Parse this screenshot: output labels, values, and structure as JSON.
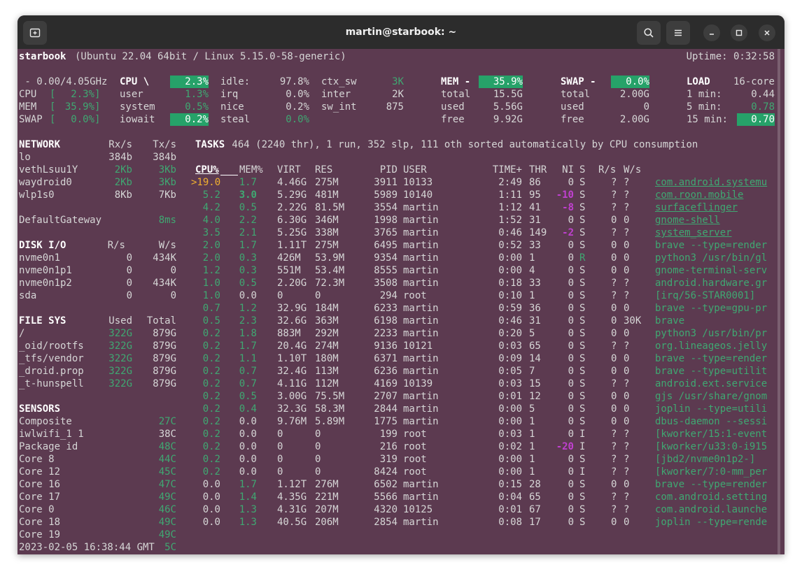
{
  "window": {
    "title": "martin@starbook: ~"
  },
  "header": {
    "host": "starbook",
    "sysinfo": "(Ubuntu 22.04 64bit / Linux 5.15.0-58-generic)",
    "uptime": "Uptime: 0:32:58"
  },
  "quicklook": {
    "freq": " - 0.00/4.05GHz",
    "rows": [
      {
        "label": "CPU",
        "pct": " 2.3%"
      },
      {
        "label": "MEM",
        "pct": "35.9%"
      },
      {
        "label": "SWAP",
        "pct": " 0.0%"
      }
    ]
  },
  "cpu": {
    "title": "CPU \\",
    "total": "2.3%",
    "rows": [
      {
        "k": "user",
        "v": "1.3%"
      },
      {
        "k": "system",
        "v": "0.5%"
      },
      {
        "k": "iowait",
        "v": "0.2%"
      }
    ],
    "rows2": [
      {
        "k": "idle:",
        "v": "97.8%"
      },
      {
        "k": "irq",
        "v": "0.0%"
      },
      {
        "k": "nice",
        "v": "0.2%"
      },
      {
        "k": "steal",
        "v": "0.0%"
      }
    ],
    "rows3": [
      {
        "k": "ctx_sw",
        "v": "3K"
      },
      {
        "k": "inter",
        "v": "2K"
      },
      {
        "k": "sw_int",
        "v": "875"
      }
    ]
  },
  "mem": {
    "title": "MEM -",
    "total_pct": "35.9%",
    "rows": [
      {
        "k": "total",
        "v": "15.5G"
      },
      {
        "k": "used",
        "v": "5.56G"
      },
      {
        "k": "free",
        "v": "9.92G"
      }
    ]
  },
  "swap": {
    "title": "SWAP -",
    "total_pct": "0.0%",
    "rows": [
      {
        "k": "total",
        "v": "2.00G"
      },
      {
        "k": "used",
        "v": "0"
      },
      {
        "k": "free",
        "v": "2.00G"
      }
    ]
  },
  "load": {
    "title": "LOAD",
    "cores": "16-core",
    "rows": [
      {
        "k": "1 min:",
        "v": "0.44"
      },
      {
        "k": "5 min:",
        "v": "0.78"
      },
      {
        "k": "15 min:",
        "v": "0.70"
      }
    ]
  },
  "network": {
    "title": "NETWORK",
    "rx": "Rx/s",
    "tx": "Tx/s",
    "rows": [
      {
        "name": "lo",
        "rx": "384b",
        "tx": "384b"
      },
      {
        "name": "vethLsuu1Y",
        "rx": "2Kb",
        "tx": "3Kb"
      },
      {
        "name": "waydroid0",
        "rx": "2Kb",
        "tx": "3Kb"
      },
      {
        "name": "wlp1s0",
        "rx": "8Kb",
        "tx": "7Kb"
      }
    ],
    "gateway": {
      "name": "DefaultGateway",
      "val": "8ms"
    }
  },
  "diskio": {
    "title": "DISK I/O",
    "r": "R/s",
    "w": "W/s",
    "rows": [
      {
        "name": "nvme0n1",
        "r": "0",
        "w": "434K"
      },
      {
        "name": "nvme0n1p1",
        "r": "0",
        "w": "0"
      },
      {
        "name": "nvme0n1p2",
        "r": "0",
        "w": "434K"
      },
      {
        "name": "sda",
        "r": "0",
        "w": "0"
      }
    ]
  },
  "filesys": {
    "title": "FILE SYS",
    "used": "Used",
    "total": "Total",
    "rows": [
      {
        "name": "/",
        "used": "322G",
        "total": "879G"
      },
      {
        "name": "_oid/rootfs",
        "used": "322G",
        "total": "879G"
      },
      {
        "name": "_tfs/vendor",
        "used": "322G",
        "total": "879G"
      },
      {
        "name": "_droid.prop",
        "used": "322G",
        "total": "879G"
      },
      {
        "name": "_t-hunspell",
        "used": "322G",
        "total": "879G"
      }
    ]
  },
  "sensors": {
    "title": "SENSORS",
    "rows": [
      {
        "name": "Composite",
        "val": "27C"
      },
      {
        "name": "iwlwifi_1 1",
        "val": "38C"
      },
      {
        "name": "Package id",
        "val": "48C"
      },
      {
        "name": "Core 8",
        "val": "44C"
      },
      {
        "name": "Core 12",
        "val": "45C"
      },
      {
        "name": "Core 16",
        "val": "47C"
      },
      {
        "name": "Core 17",
        "val": "49C"
      },
      {
        "name": "Core 0",
        "val": "46C"
      },
      {
        "name": "Core 18",
        "val": "49C"
      },
      {
        "name": "Core 19",
        "val": "49C"
      }
    ]
  },
  "footer": {
    "datetime": "2023-02-05 16:38:44 GMT",
    "lastsensor": "5C"
  },
  "tasks": {
    "summary_label": "TASKS",
    "summary": " 464 (2240 thr), 1 run, 352 slp, 111 oth sorted automatically by CPU consumption",
    "headers": {
      "cpu": "CPU%",
      "mem": "MEM%",
      "virt": "VIRT",
      "res": "RES",
      "pid": "PID",
      "user": "USER",
      "time": "TIME+",
      "thr": "THR",
      "ni": "NI",
      "s": "S",
      "rs": "R/s",
      "ws": "W/s"
    },
    "rows": [
      {
        "cpu": ">19.0",
        "mem": "1.7",
        "virt": "4.46G",
        "res": "275M",
        "pid": "3911",
        "user": "10133",
        "time": "2:49",
        "thr": "86",
        "ni": "0",
        "s": "S",
        "rs": "?",
        "ws": "?",
        "cmd": "com.android.systemu"
      },
      {
        "cpu": "5.2",
        "mem": "3.0",
        "virt": "5.29G",
        "res": "481M",
        "pid": "5989",
        "user": "10140",
        "time": "1:11",
        "thr": "95",
        "ni": "-10",
        "s": "S",
        "rs": "?",
        "ws": "?",
        "cmd": "com.roon.mobile"
      },
      {
        "cpu": "4.2",
        "mem": "0.5",
        "virt": "2.22G",
        "res": "81.5M",
        "pid": "3554",
        "user": "martin",
        "time": "1:12",
        "thr": "41",
        "ni": "-8",
        "s": "S",
        "rs": "?",
        "ws": "?",
        "cmd": "surfaceflinger"
      },
      {
        "cpu": "4.0",
        "mem": "2.2",
        "virt": "6.30G",
        "res": "346M",
        "pid": "1998",
        "user": "martin",
        "time": "1:52",
        "thr": "31",
        "ni": "0",
        "s": "S",
        "rs": "0",
        "ws": "0",
        "cmd": "gnome-shell"
      },
      {
        "cpu": "3.5",
        "mem": "2.1",
        "virt": "5.25G",
        "res": "338M",
        "pid": "3765",
        "user": "martin",
        "time": "0:46",
        "thr": "149",
        "ni": "-2",
        "s": "S",
        "rs": "?",
        "ws": "?",
        "cmd": "system_server"
      },
      {
        "cpu": "2.0",
        "mem": "1.7",
        "virt": "1.11T",
        "res": "275M",
        "pid": "6495",
        "user": "martin",
        "time": "0:52",
        "thr": "33",
        "ni": "0",
        "s": "S",
        "rs": "0",
        "ws": "0",
        "cmd": "brave --type=render"
      },
      {
        "cpu": "2.0",
        "mem": "0.3",
        "virt": "426M",
        "res": "53.9M",
        "pid": "9354",
        "user": "martin",
        "time": "0:00",
        "thr": "1",
        "ni": "0",
        "s": "R",
        "rs": "0",
        "ws": "0",
        "cmd": "python3 /usr/bin/gl"
      },
      {
        "cpu": "1.2",
        "mem": "0.3",
        "virt": "551M",
        "res": "53.4M",
        "pid": "8555",
        "user": "martin",
        "time": "0:00",
        "thr": "4",
        "ni": "0",
        "s": "S",
        "rs": "0",
        "ws": "0",
        "cmd": "gnome-terminal-serv"
      },
      {
        "cpu": "1.0",
        "mem": "0.5",
        "virt": "2.20G",
        "res": "72.3M",
        "pid": "3508",
        "user": "martin",
        "time": "0:18",
        "thr": "33",
        "ni": "0",
        "s": "S",
        "rs": "?",
        "ws": "?",
        "cmd": "android.hardware.gr"
      },
      {
        "cpu": "1.0",
        "mem": "0.0",
        "virt": "0",
        "res": "0",
        "pid": "294",
        "user": "root",
        "time": "0:10",
        "thr": "1",
        "ni": "0",
        "s": "S",
        "rs": "?",
        "ws": "?",
        "cmd": "[irq/56-STAR0001]"
      },
      {
        "cpu": "0.7",
        "mem": "1.2",
        "virt": "32.9G",
        "res": "184M",
        "pid": "6233",
        "user": "martin",
        "time": "0:59",
        "thr": "36",
        "ni": "0",
        "s": "S",
        "rs": "0",
        "ws": "0",
        "cmd": "brave --type=gpu-pr"
      },
      {
        "cpu": "0.5",
        "mem": "2.3",
        "virt": "32.6G",
        "res": "363M",
        "pid": "6198",
        "user": "martin",
        "time": "0:46",
        "thr": "31",
        "ni": "0",
        "s": "S",
        "rs": "0",
        "ws": "30K",
        "cmd": "brave"
      },
      {
        "cpu": "0.2",
        "mem": "1.8",
        "virt": "883M",
        "res": "292M",
        "pid": "2233",
        "user": "martin",
        "time": "0:20",
        "thr": "5",
        "ni": "0",
        "s": "S",
        "rs": "0",
        "ws": "0",
        "cmd": "python3 /usr/bin/pr"
      },
      {
        "cpu": "0.2",
        "mem": "1.7",
        "virt": "20.4G",
        "res": "274M",
        "pid": "9136",
        "user": "10121",
        "time": "0:03",
        "thr": "65",
        "ni": "0",
        "s": "S",
        "rs": "?",
        "ws": "?",
        "cmd": "org.lineageos.jelly"
      },
      {
        "cpu": "0.2",
        "mem": "1.1",
        "virt": "1.10T",
        "res": "180M",
        "pid": "6371",
        "user": "martin",
        "time": "0:09",
        "thr": "14",
        "ni": "0",
        "s": "S",
        "rs": "0",
        "ws": "0",
        "cmd": "brave --type=render"
      },
      {
        "cpu": "0.2",
        "mem": "0.7",
        "virt": "32.4G",
        "res": "113M",
        "pid": "6236",
        "user": "martin",
        "time": "0:05",
        "thr": "7",
        "ni": "0",
        "s": "S",
        "rs": "0",
        "ws": "0",
        "cmd": "brave --type=utilit"
      },
      {
        "cpu": "0.2",
        "mem": "0.7",
        "virt": "4.11G",
        "res": "112M",
        "pid": "4169",
        "user": "10139",
        "time": "0:03",
        "thr": "15",
        "ni": "0",
        "s": "S",
        "rs": "?",
        "ws": "?",
        "cmd": "android.ext.service"
      },
      {
        "cpu": "0.2",
        "mem": "0.5",
        "virt": "3.00G",
        "res": "75.5M",
        "pid": "2707",
        "user": "martin",
        "time": "0:01",
        "thr": "12",
        "ni": "0",
        "s": "S",
        "rs": "0",
        "ws": "0",
        "cmd": "gjs /usr/share/gnom"
      },
      {
        "cpu": "0.2",
        "mem": "0.4",
        "virt": "32.3G",
        "res": "58.3M",
        "pid": "2844",
        "user": "martin",
        "time": "0:00",
        "thr": "5",
        "ni": "0",
        "s": "S",
        "rs": "0",
        "ws": "0",
        "cmd": "joplin --type=utili"
      },
      {
        "cpu": "0.2",
        "mem": "0.0",
        "virt": "9.76M",
        "res": "5.89M",
        "pid": "1775",
        "user": "martin",
        "time": "0:00",
        "thr": "1",
        "ni": "0",
        "s": "S",
        "rs": "0",
        "ws": "0",
        "cmd": "dbus-daemon --sessi"
      },
      {
        "cpu": "0.2",
        "mem": "0.0",
        "virt": "0",
        "res": "0",
        "pid": "199",
        "user": "root",
        "time": "0:03",
        "thr": "1",
        "ni": "0",
        "s": "I",
        "rs": "?",
        "ws": "?",
        "cmd": "[kworker/15:1-event"
      },
      {
        "cpu": "0.2",
        "mem": "0.0",
        "virt": "0",
        "res": "0",
        "pid": "216",
        "user": "root",
        "time": "0:02",
        "thr": "1",
        "ni": "-20",
        "s": "I",
        "rs": "?",
        "ws": "?",
        "cmd": "[kworker/u33:0-i915"
      },
      {
        "cpu": "0.2",
        "mem": "0.0",
        "virt": "0",
        "res": "0",
        "pid": "319",
        "user": "root",
        "time": "0:00",
        "thr": "1",
        "ni": "0",
        "s": "S",
        "rs": "?",
        "ws": "?",
        "cmd": "[jbd2/nvme0n1p2-]"
      },
      {
        "cpu": "0.2",
        "mem": "0.0",
        "virt": "0",
        "res": "0",
        "pid": "8424",
        "user": "root",
        "time": "0:00",
        "thr": "1",
        "ni": "0",
        "s": "I",
        "rs": "?",
        "ws": "?",
        "cmd": "[kworker/7:0-mm_per"
      },
      {
        "cpu": "0.0",
        "mem": "1.7",
        "virt": "1.12T",
        "res": "276M",
        "pid": "6502",
        "user": "martin",
        "time": "0:15",
        "thr": "28",
        "ni": "0",
        "s": "S",
        "rs": "0",
        "ws": "0",
        "cmd": "brave --type=render"
      },
      {
        "cpu": "0.0",
        "mem": "1.4",
        "virt": "4.35G",
        "res": "221M",
        "pid": "5566",
        "user": "martin",
        "time": "0:04",
        "thr": "65",
        "ni": "0",
        "s": "S",
        "rs": "?",
        "ws": "?",
        "cmd": "com.android.setting"
      },
      {
        "cpu": "0.0",
        "mem": "1.3",
        "virt": "4.31G",
        "res": "207M",
        "pid": "4320",
        "user": "10125",
        "time": "0:01",
        "thr": "67",
        "ni": "0",
        "s": "S",
        "rs": "?",
        "ws": "?",
        "cmd": "com.android.launche"
      },
      {
        "cpu": "0.0",
        "mem": "1.3",
        "virt": "40.5G",
        "res": "206M",
        "pid": "2854",
        "user": "martin",
        "time": "0:08",
        "thr": "17",
        "ni": "0",
        "s": "S",
        "rs": "0",
        "ws": "0",
        "cmd": "joplin --type=rende"
      }
    ]
  },
  "colors": {
    "bg": "#5c3a50",
    "titlebar": "#2c2c2c",
    "green": "#3fa872",
    "highlight": "#26a269",
    "magenta": "#c040d0"
  },
  "icons": {
    "new_tab": "new-tab-icon",
    "search": "search-icon",
    "menu": "hamburger-menu-icon",
    "minimize": "minimize-icon",
    "maximize": "maximize-icon",
    "close": "close-icon"
  }
}
